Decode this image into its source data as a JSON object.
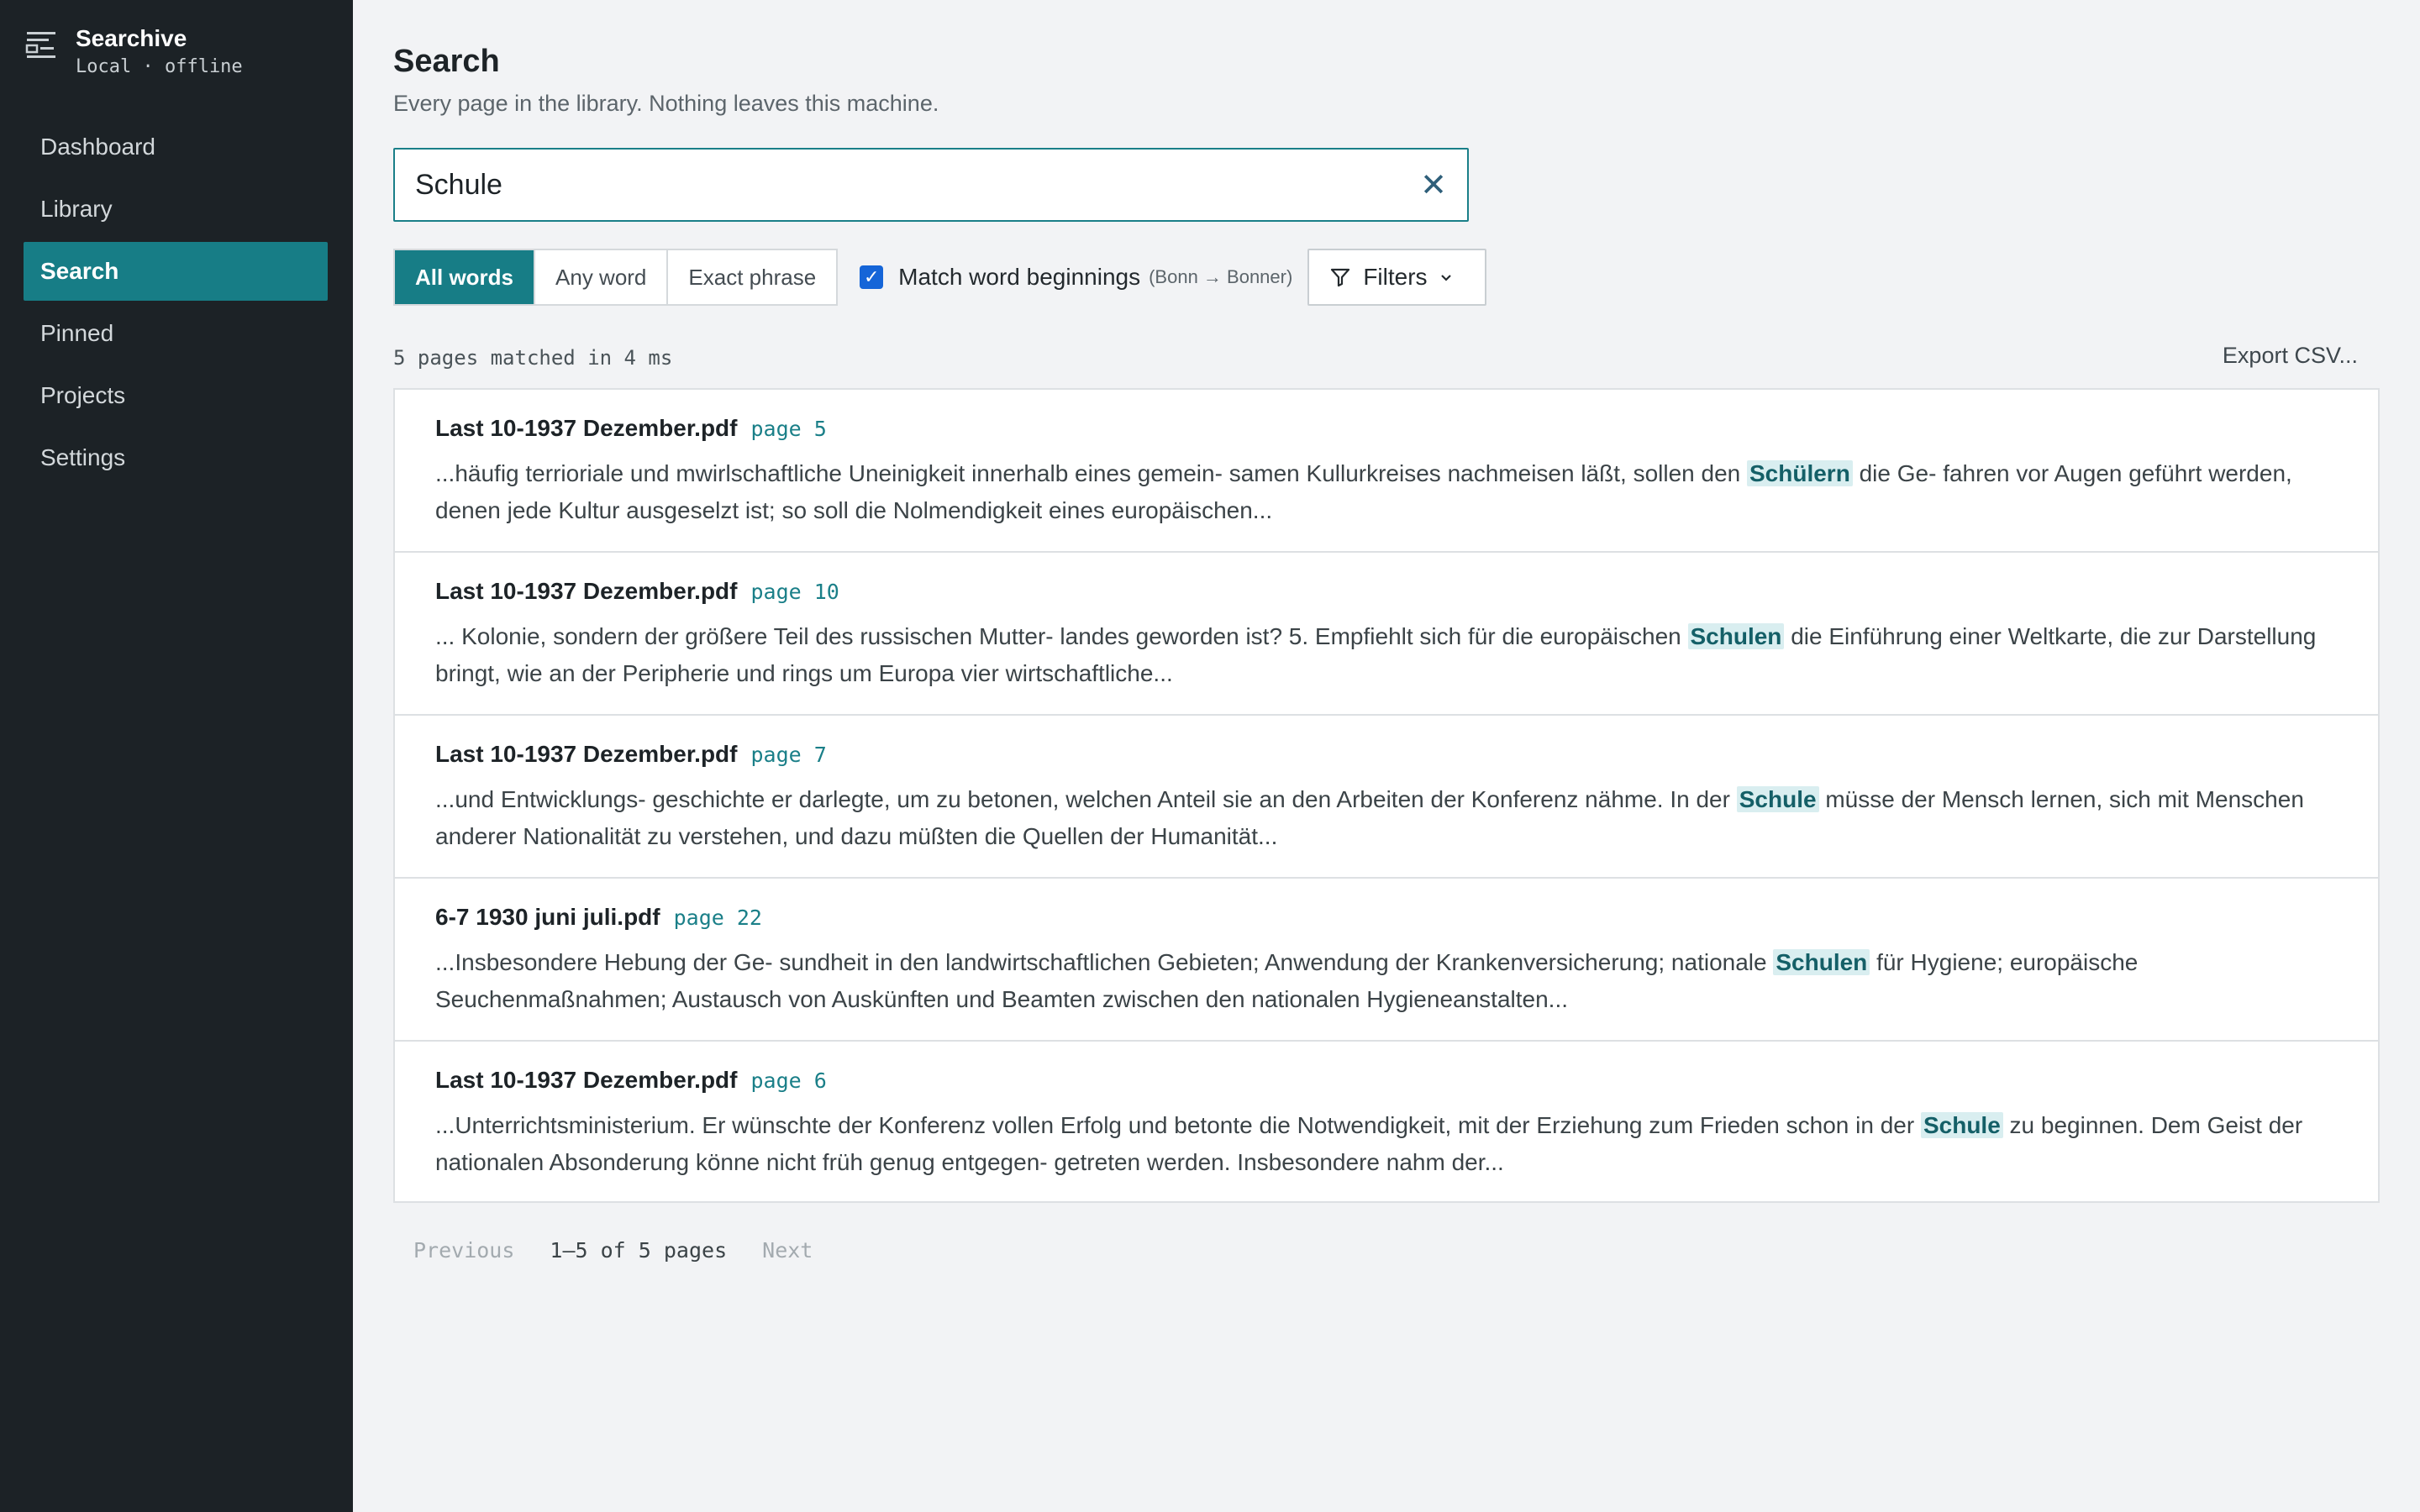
{
  "app": {
    "name": "Searchive",
    "status": "Local · offline"
  },
  "nav": {
    "items": [
      {
        "label": "Dashboard",
        "active": false
      },
      {
        "label": "Library",
        "active": false
      },
      {
        "label": "Search",
        "active": true
      },
      {
        "label": "Pinned",
        "active": false
      },
      {
        "label": "Projects",
        "active": false
      },
      {
        "label": "Settings",
        "active": false
      }
    ]
  },
  "page": {
    "title": "Search",
    "subtitle": "Every page in the library. Nothing leaves this machine."
  },
  "search": {
    "value": "Schule",
    "clear_icon": "close-icon"
  },
  "mode": {
    "options": [
      "All words",
      "Any word",
      "Exact phrase"
    ],
    "selected": "All words"
  },
  "options": {
    "match_beginnings_label": "Match word beginnings",
    "match_beginnings_hint": "(Bonn → Bonner)",
    "match_beginnings_checked": true,
    "filters_label": "Filters"
  },
  "results_meta": {
    "summary": "5 pages matched in 4 ms",
    "export_label": "Export CSV..."
  },
  "results": [
    {
      "file": "Last 10-1937 Dezember.pdf",
      "page": "page 5",
      "before": "...häufig terrioriale und mwirlschaftliche Uneinigkeit innerhalb eines gemein- samen Kullurkreises nachmeisen läßt, sollen den ",
      "match": "Schülern",
      "after": " die Ge- fahren vor Augen geführt werden, denen jede Kultur ausgeselzt ist; so soll die Nolmendigkeit eines europäischen..."
    },
    {
      "file": "Last 10-1937 Dezember.pdf",
      "page": "page 10",
      "before": "... Kolonie, sondern der größere Teil des russischen Mutter- landes geworden ist? 5. Empfiehlt sich für die europäischen ",
      "match": "Schulen",
      "after": " die Einführung einer Weltkarte, die zur Darstellung bringt, wie an der Peripherie und rings um Europa vier wirtschaftliche..."
    },
    {
      "file": "Last 10-1937 Dezember.pdf",
      "page": "page 7",
      "before": "...und Entwicklungs- geschichte er darlegte, um zu betonen, welchen Anteil sie an den Arbeiten der Konferenz nähme. In der ",
      "match": "Schule",
      "after": " müsse der Mensch lernen, sich mit Menschen anderer Nationalität zu verstehen, und dazu müßten die Quellen der Humanität..."
    },
    {
      "file": "6-7 1930 juni juli.pdf",
      "page": "page 22",
      "before": "...Insbesondere Hebung der Ge- sundheit in den landwirtschaftlichen Gebieten; Anwendung der Krankenversicherung; nationale ",
      "match": "Schulen",
      "after": " für Hygiene; europäische Seuchenmaßnahmen; Austausch von Auskünften und Beamten zwischen den nationalen Hygieneanstalten..."
    },
    {
      "file": "Last 10-1937 Dezember.pdf",
      "page": "page 6",
      "before": "...Unterrichtsministerium. Er wünschte der Konferenz vollen Erfolg und betonte die Notwendigkeit, mit der Erziehung zum Frieden schon in der ",
      "match": "Schule",
      "after": " zu beginnen. Dem Geist der nationalen Absonderung könne nicht früh genug entgegen- getreten werden. Insbesondere nahm der..."
    }
  ],
  "pager": {
    "prev": "Previous",
    "info": "1–5 of 5 pages",
    "next": "Next"
  },
  "colors": {
    "accent": "#177d86",
    "sidebar_bg": "#1c2226",
    "highlight_bg": "#d9eef0"
  }
}
